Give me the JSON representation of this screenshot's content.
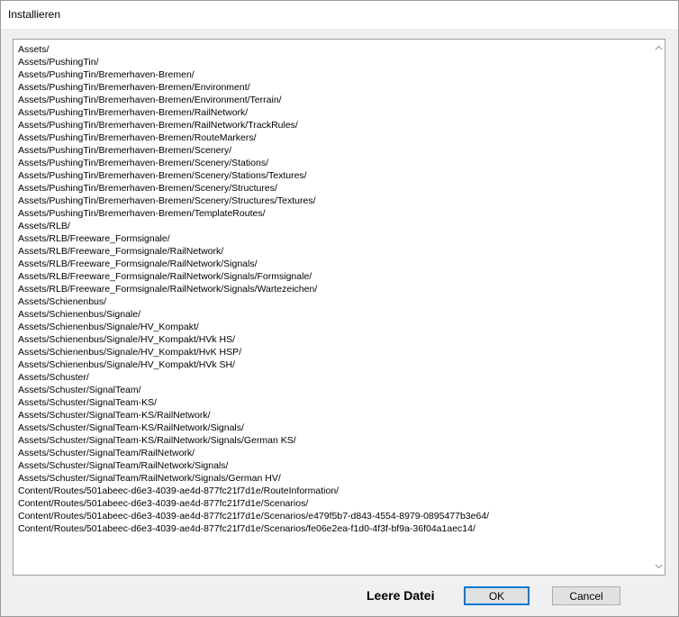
{
  "window": {
    "title": "Installieren"
  },
  "list": {
    "items": [
      "Assets/",
      "Assets/PushingTin/",
      "Assets/PushingTin/Bremerhaven-Bremen/",
      "Assets/PushingTin/Bremerhaven-Bremen/Environment/",
      "Assets/PushingTin/Bremerhaven-Bremen/Environment/Terrain/",
      "Assets/PushingTin/Bremerhaven-Bremen/RailNetwork/",
      "Assets/PushingTin/Bremerhaven-Bremen/RailNetwork/TrackRules/",
      "Assets/PushingTin/Bremerhaven-Bremen/RouteMarkers/",
      "Assets/PushingTin/Bremerhaven-Bremen/Scenery/",
      "Assets/PushingTin/Bremerhaven-Bremen/Scenery/Stations/",
      "Assets/PushingTin/Bremerhaven-Bremen/Scenery/Stations/Textures/",
      "Assets/PushingTin/Bremerhaven-Bremen/Scenery/Structures/",
      "Assets/PushingTin/Bremerhaven-Bremen/Scenery/Structures/Textures/",
      "Assets/PushingTin/Bremerhaven-Bremen/TemplateRoutes/",
      "Assets/RLB/",
      "Assets/RLB/Freeware_Formsignale/",
      "Assets/RLB/Freeware_Formsignale/RailNetwork/",
      "Assets/RLB/Freeware_Formsignale/RailNetwork/Signals/",
      "Assets/RLB/Freeware_Formsignale/RailNetwork/Signals/Formsignale/",
      "Assets/RLB/Freeware_Formsignale/RailNetwork/Signals/Wartezeichen/",
      "Assets/Schienenbus/",
      "Assets/Schienenbus/Signale/",
      "Assets/Schienenbus/Signale/HV_Kompakt/",
      "Assets/Schienenbus/Signale/HV_Kompakt/HVk HS/",
      "Assets/Schienenbus/Signale/HV_Kompakt/HvK HSP/",
      "Assets/Schienenbus/Signale/HV_Kompakt/HVk SH/",
      "Assets/Schuster/",
      "Assets/Schuster/SignalTeam/",
      "Assets/Schuster/SignalTeam-KS/",
      "Assets/Schuster/SignalTeam-KS/RailNetwork/",
      "Assets/Schuster/SignalTeam-KS/RailNetwork/Signals/",
      "Assets/Schuster/SignalTeam-KS/RailNetwork/Signals/German KS/",
      "Assets/Schuster/SignalTeam/RailNetwork/",
      "Assets/Schuster/SignalTeam/RailNetwork/Signals/",
      "Assets/Schuster/SignalTeam/RailNetwork/Signals/German HV/",
      "Content/Routes/501abeec-d6e3-4039-ae4d-877fc21f7d1e/RouteInformation/",
      "Content/Routes/501abeec-d6e3-4039-ae4d-877fc21f7d1e/Scenarios/",
      "Content/Routes/501abeec-d6e3-4039-ae4d-877fc21f7d1e/Scenarios/e479f5b7-d843-4554-8979-0895477b3e64/",
      "Content/Routes/501abeec-d6e3-4039-ae4d-877fc21f7d1e/Scenarios/fe06e2ea-f1d0-4f3f-bf9a-36f04a1aec14/"
    ]
  },
  "scrollbar": {
    "up_icon": "chevron-up-icon",
    "down_icon": "chevron-down-icon"
  },
  "footer": {
    "status_text": "Leere Datei",
    "ok_label": "OK",
    "cancel_label": "Cancel",
    "accent_color": "#0078d7"
  }
}
